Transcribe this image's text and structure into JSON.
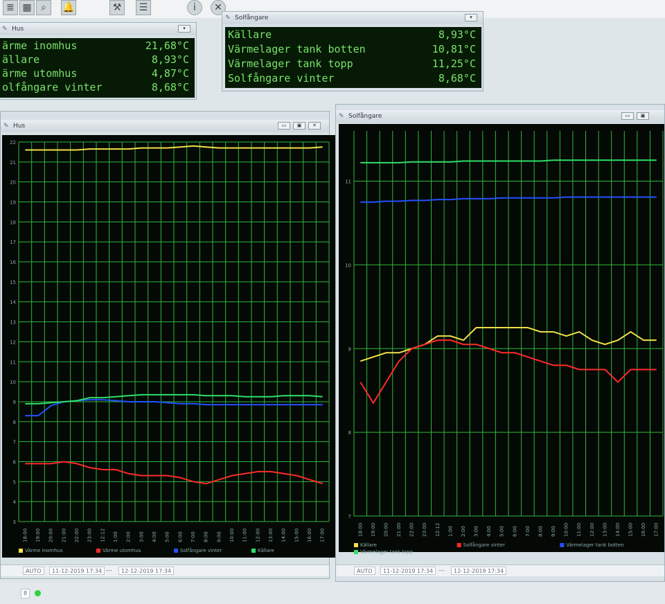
{
  "toolbar": {
    "icons": [
      "database-icon",
      "magnifier-icon",
      "bell-icon",
      "tools-icon",
      "list-icon",
      "info-icon",
      "close-circle-icon"
    ]
  },
  "colors": {
    "lcd_text": "#7be36b",
    "lcd_bg": "#061a06",
    "grid": "#2fb83a",
    "yellow": "#f2e04a",
    "red": "#ff2a2a",
    "blue": "#2350ff",
    "green": "#2fe06a"
  },
  "hus_panel": {
    "title": "Hus",
    "rows": [
      {
        "name": "ärme inomhus",
        "value": "21,68°C"
      },
      {
        "name": "ällare",
        "value": "8,93°C"
      },
      {
        "name": "ärme utomhus",
        "value": "4,87°C"
      },
      {
        "name": "olfångare vinter",
        "value": "8,68°C"
      }
    ]
  },
  "solf_panel": {
    "title": "Solfångare",
    "rows": [
      {
        "name": "Källare",
        "value": "8,93°C"
      },
      {
        "name": "Värmelager tank botten",
        "value": "10,81°C"
      },
      {
        "name": "Värmelager tank topp",
        "value": "11,25°C"
      },
      {
        "name": "Solfångare vinter",
        "value": "8,68°C"
      }
    ]
  },
  "chart_data": [
    {
      "title": "Hus",
      "type": "line",
      "x": [
        "18:00",
        "19:00",
        "20:00",
        "21:00",
        "22:00",
        "23:00",
        "12:12",
        "1:00",
        "2:00",
        "3:00",
        "4:00",
        "5:00",
        "6:00",
        "7:00",
        "8:00",
        "9:00",
        "10:00",
        "11:00",
        "12:00",
        "13:00",
        "14:00",
        "15:00",
        "16:00",
        "17:00"
      ],
      "y_ticks": [
        3,
        4,
        5,
        6,
        7,
        8,
        9,
        10,
        11,
        12,
        13,
        14,
        15,
        16,
        17,
        18,
        19,
        20,
        21,
        22
      ],
      "ylim": [
        3,
        22
      ],
      "grid": true,
      "legend_position": "bottom",
      "series": [
        {
          "name": "Värme inomhus",
          "color": "#f2e04a",
          "values": [
            21.6,
            21.6,
            21.6,
            21.6,
            21.6,
            21.65,
            21.65,
            21.65,
            21.65,
            21.7,
            21.7,
            21.7,
            21.75,
            21.8,
            21.75,
            21.7,
            21.7,
            21.7,
            21.7,
            21.7,
            21.7,
            21.7,
            21.7,
            21.75
          ]
        },
        {
          "name": "Värme utomhus",
          "color": "#ff2a2a",
          "values": [
            5.9,
            5.9,
            5.9,
            6.0,
            5.9,
            5.7,
            5.6,
            5.6,
            5.4,
            5.3,
            5.3,
            5.3,
            5.2,
            5.0,
            4.9,
            5.1,
            5.3,
            5.4,
            5.5,
            5.5,
            5.4,
            5.3,
            5.1,
            4.9
          ]
        },
        {
          "name": "Solfångare vinter",
          "color": "#2350ff",
          "values": [
            8.3,
            8.3,
            8.8,
            9.0,
            9.05,
            9.1,
            9.1,
            9.05,
            9.0,
            9.0,
            9.0,
            8.95,
            8.9,
            8.9,
            8.85,
            8.85,
            8.85,
            8.85,
            8.85,
            8.85,
            8.85,
            8.85,
            8.85,
            8.85
          ]
        },
        {
          "name": "Källare",
          "color": "#2fe06a",
          "values": [
            8.9,
            8.9,
            8.95,
            9.0,
            9.05,
            9.2,
            9.2,
            9.25,
            9.3,
            9.35,
            9.35,
            9.35,
            9.35,
            9.35,
            9.3,
            9.3,
            9.3,
            9.25,
            9.25,
            9.25,
            9.3,
            9.3,
            9.3,
            9.25
          ]
        }
      ]
    },
    {
      "title": "Solfångare",
      "type": "line",
      "x": [
        "18:00",
        "19:00",
        "20:00",
        "21:00",
        "22:00",
        "23:00",
        "12:12",
        "1:00",
        "2:00",
        "3:00",
        "4:00",
        "5:00",
        "6:00",
        "7:00",
        "8:00",
        "9:00",
        "10:00",
        "11:00",
        "12:00",
        "13:00",
        "14:00",
        "15:00",
        "16:00",
        "17:00"
      ],
      "y_ticks": [
        7,
        8,
        9,
        10,
        11
      ],
      "ylim": [
        7,
        11.6
      ],
      "grid": true,
      "legend_position": "bottom",
      "series": [
        {
          "name": "Källare",
          "color": "#f2e04a",
          "values": [
            8.85,
            8.9,
            8.95,
            8.95,
            9.0,
            9.05,
            9.15,
            9.15,
            9.1,
            9.25,
            9.25,
            9.25,
            9.25,
            9.25,
            9.2,
            9.2,
            9.15,
            9.2,
            9.1,
            9.05,
            9.1,
            9.2,
            9.1,
            9.1
          ]
        },
        {
          "name": "Solfångare vinter",
          "color": "#ff2a2a",
          "values": [
            8.6,
            8.35,
            8.6,
            8.85,
            9.0,
            9.05,
            9.1,
            9.1,
            9.05,
            9.05,
            9.0,
            8.95,
            8.95,
            8.9,
            8.85,
            8.8,
            8.8,
            8.75,
            8.75,
            8.75,
            8.6,
            8.75,
            8.75,
            8.75
          ]
        },
        {
          "name": "Värmelager tank botten",
          "color": "#2350ff",
          "values": [
            10.75,
            10.75,
            10.76,
            10.76,
            10.77,
            10.77,
            10.78,
            10.78,
            10.79,
            10.79,
            10.79,
            10.8,
            10.8,
            10.8,
            10.8,
            10.8,
            10.81,
            10.81,
            10.81,
            10.81,
            10.81,
            10.81,
            10.81,
            10.81
          ]
        },
        {
          "name": "Värmelager tank topp",
          "color": "#2fe06a",
          "values": [
            11.22,
            11.22,
            11.22,
            11.22,
            11.23,
            11.23,
            11.23,
            11.23,
            11.24,
            11.24,
            11.24,
            11.24,
            11.24,
            11.24,
            11.24,
            11.25,
            11.25,
            11.25,
            11.25,
            11.25,
            11.25,
            11.25,
            11.25,
            11.25
          ]
        }
      ]
    }
  ],
  "hus_status": {
    "mode": "AUTO",
    "from": "11-12-2019 17:34",
    "sep": "---",
    "to": "12-12-2019 17:34"
  },
  "solf_status": {
    "mode": "AUTO",
    "from": "11-12-2019 17:34",
    "sep": "---",
    "to": "12-12-2019 17:34"
  },
  "bottom": {
    "field": "8"
  }
}
